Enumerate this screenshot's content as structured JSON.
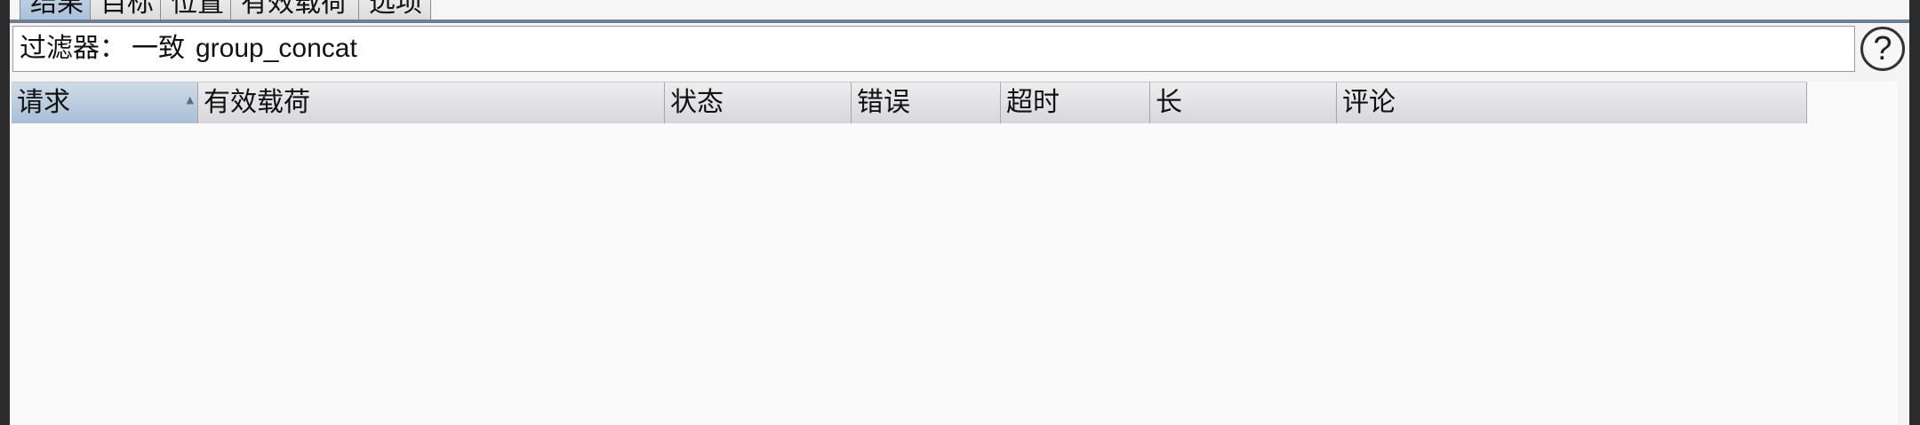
{
  "tabs": [
    {
      "label": "结果",
      "active": true
    },
    {
      "label": "目标",
      "active": false
    },
    {
      "label": "位置",
      "active": false
    },
    {
      "label": "有效载荷",
      "active": false
    },
    {
      "label": "选项",
      "active": false
    }
  ],
  "filter": {
    "label": "过滤器：",
    "mode": "一致",
    "value": "group_concat"
  },
  "help": {
    "symbol": "?"
  },
  "table": {
    "columns": [
      {
        "label": "请求",
        "sorted": true
      },
      {
        "label": "有效载荷"
      },
      {
        "label": "状态"
      },
      {
        "label": "错误"
      },
      {
        "label": "超时"
      },
      {
        "label": "长"
      },
      {
        "label": "评论"
      }
    ],
    "sort_indicator": "▲",
    "rows": []
  },
  "colors": {
    "active_tab": "#a8c0da",
    "sorted_header": "#a9bfd6",
    "window_frame": "#2b2b2b"
  }
}
